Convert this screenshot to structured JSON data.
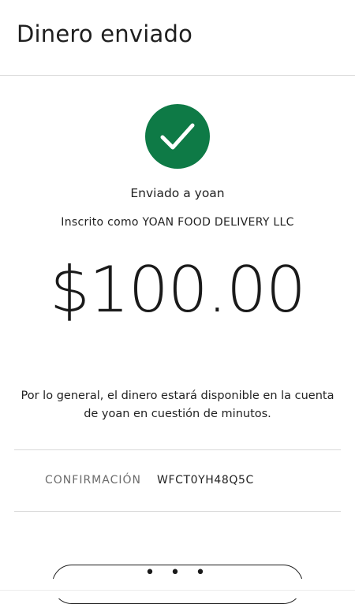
{
  "header": {
    "title": "Dinero enviado"
  },
  "status": {
    "icon": "checkmark-icon",
    "color": "#0e7a46"
  },
  "recipient": {
    "sent_to": "Enviado a yoan",
    "registered_as": "Inscrito como YOAN FOOD DELIVERY LLC"
  },
  "amount": "$100.00",
  "availability_note": "Por lo general, el dinero estará disponible en la cuenta de yoan en cuestión de minutos.",
  "confirmation": {
    "label": "CONFIRMACIÓN",
    "value": "WFCT0YH48Q5C"
  },
  "more_button": {
    "label": "• • •",
    "icon": "more-dots-icon"
  }
}
